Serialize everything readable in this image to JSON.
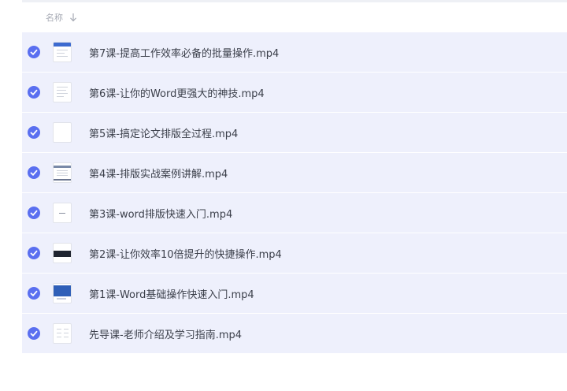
{
  "header": {
    "name_label": "名称",
    "sort_icon": "arrow-down-icon"
  },
  "files": [
    {
      "name": "第7课-提高工作效率必备的批量操作.mp4",
      "selected": true,
      "thumb": "doc-blue"
    },
    {
      "name": "第6课-让你的Word更强大的神技.mp4",
      "selected": true,
      "thumb": "doc-lines"
    },
    {
      "name": "第5课-搞定论文排版全过程.mp4",
      "selected": true,
      "thumb": "blank"
    },
    {
      "name": "第4课-排版实战案例讲解.mp4",
      "selected": true,
      "thumb": "doc-table"
    },
    {
      "name": "第3课-word排版快速入门.mp4",
      "selected": true,
      "thumb": "doc-center"
    },
    {
      "name": "第2课-让你效率10倍提升的快捷操作.mp4",
      "selected": true,
      "thumb": "dark-band"
    },
    {
      "name": "第1课-Word基础操作快速入门.mp4",
      "selected": true,
      "thumb": "blue-header"
    },
    {
      "name": "先导课-老师介绍及学习指南.mp4",
      "selected": true,
      "thumb": "doc-grid"
    }
  ],
  "colors": {
    "row_bg": "#eef0fc",
    "check_bg": "#5a6ff0",
    "text": "#3b3f4a",
    "header_text": "#a7abb5"
  }
}
